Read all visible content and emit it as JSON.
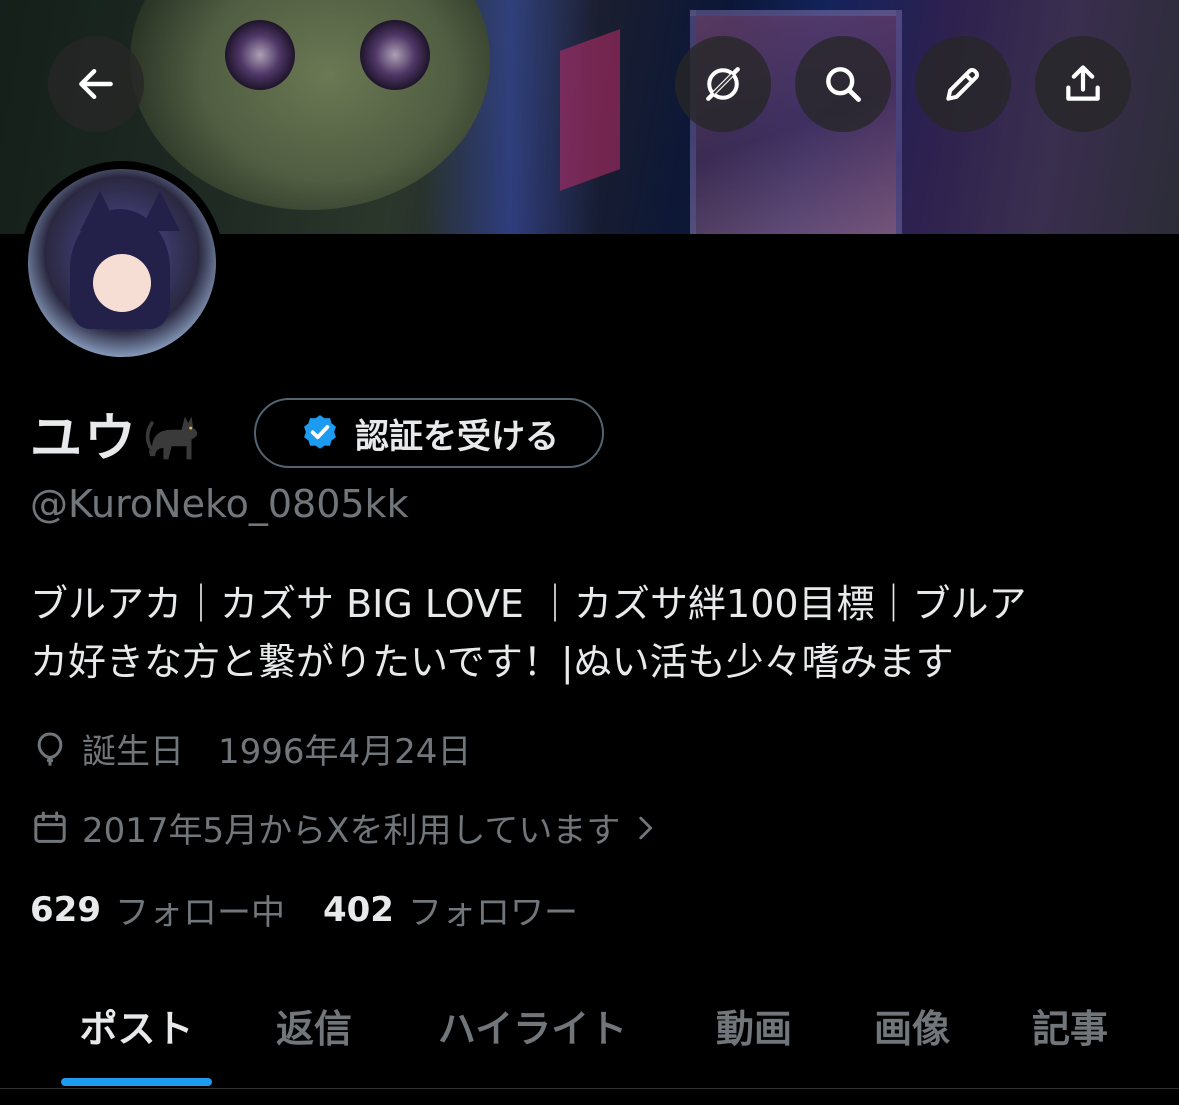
{
  "header": {
    "back_icon": "arrow-left-icon",
    "grok_icon": "grok-icon",
    "search_icon": "search-icon",
    "edit_icon": "pencil-icon",
    "share_icon": "share-icon"
  },
  "profile": {
    "display_name": "ユウ",
    "name_emoji": "black-cat-icon",
    "verify_label": "認証を受ける",
    "handle": "@KuroNeko_0805kk",
    "bio_line1": "ブルアカ｜カズサ BIG LOVE ｜カズサ絆100目標｜ブルア",
    "bio_line2": "カ好きな方と繋がりたいです！|ぬい活も少々嗜みます",
    "birthday": "誕生日　1996年4月24日",
    "joined": "2017年5月からXを利用しています",
    "following_count": "629",
    "following_label": "フォロー中",
    "followers_count": "402",
    "followers_label": "フォロワー"
  },
  "tabs": [
    {
      "label": "ポスト"
    },
    {
      "label": "返信"
    },
    {
      "label": "ハイライト"
    },
    {
      "label": "動画"
    },
    {
      "label": "画像"
    },
    {
      "label": "記事"
    }
  ],
  "colors": {
    "accent": "#1d9bf0",
    "background": "#000000",
    "text_primary": "#e7e9ea",
    "text_secondary": "#71767b",
    "verify_badge": "#1d9bf0"
  }
}
